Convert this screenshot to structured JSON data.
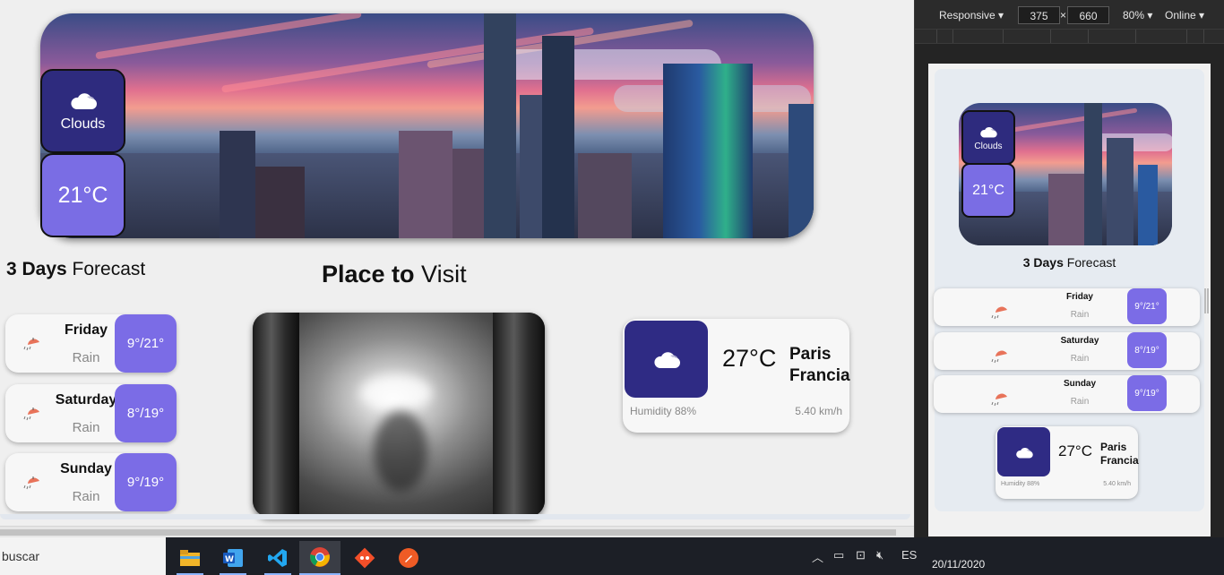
{
  "hero": {
    "condition": "Clouds",
    "temperature": "21°C"
  },
  "forecast": {
    "title_bold": "3 Days",
    "title_rest": " Forecast",
    "days": [
      {
        "day": "Friday",
        "desc": "Rain",
        "temps": "9°/21°"
      },
      {
        "day": "Saturday",
        "desc": "Rain",
        "temps": "8°/19°"
      },
      {
        "day": "Sunday",
        "desc": "Rain",
        "temps": "9°/19°"
      }
    ]
  },
  "places": {
    "title_bold": "Place to",
    "title_rest": " Visit"
  },
  "weather_card": {
    "temperature": "27°C",
    "city": "Paris",
    "country": "Francia",
    "humidity": "Humidity 88%",
    "wind": "5.40 km/h"
  },
  "mobile": {
    "forecast_days": [
      {
        "day": "Friday",
        "desc": "Rain",
        "temps": "9°/21°"
      },
      {
        "day": "Saturday",
        "desc": "Rain",
        "temps": "8°/19°"
      },
      {
        "day": "Sunday",
        "desc": "Rain",
        "temps": "9°/19°"
      }
    ]
  },
  "devtools": {
    "device": "Responsive",
    "width": "375",
    "times": "×",
    "height": "660",
    "zoom": "80%",
    "network": "Online"
  },
  "taskbar": {
    "search_text": "buscar",
    "lang": "ES",
    "date": "20/11/2020",
    "apps": [
      "file-explorer",
      "word",
      "vscode",
      "chrome",
      "git",
      "postman"
    ]
  },
  "colors": {
    "accent_dark": "#2e2b7e",
    "accent_light": "#7a6de4",
    "rain_icon": "#e8735a"
  }
}
